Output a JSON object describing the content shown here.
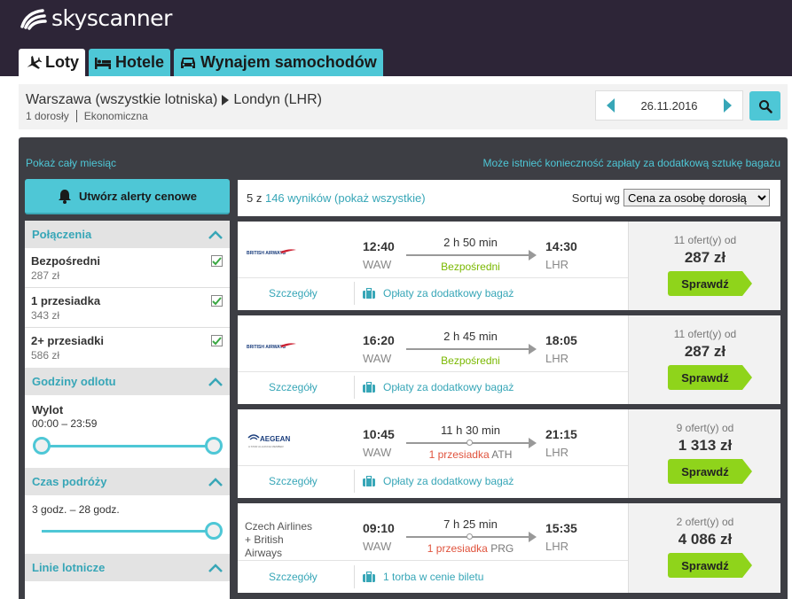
{
  "brand": {
    "name": "skyscanner"
  },
  "tabs": [
    {
      "label": "Loty",
      "icon": "plane-icon",
      "active": true
    },
    {
      "label": "Hotele",
      "icon": "bed-icon",
      "active": false
    },
    {
      "label": "Wynajem samochodów",
      "icon": "car-icon",
      "active": false
    }
  ],
  "search": {
    "origin": "Warszawa (wszystkie lotniska)",
    "destination": "Londyn (LHR)",
    "passengers": "1 dorosły",
    "cabin": "Ekonomiczna",
    "date": "26.11.2016"
  },
  "links": {
    "month": "Pokaż cały miesiąc",
    "baggage_notice": "Może istnieć konieczność zapłaty za dodatkową sztukę bagażu"
  },
  "sidebar": {
    "alert_button": "Utwórz alerty cenowe",
    "connections_title": "Połączenia",
    "connections": [
      {
        "name": "Bezpośredni",
        "price": "287 zł",
        "checked": true
      },
      {
        "name": "1 przesiadka",
        "price": "343 zł",
        "checked": true
      },
      {
        "name": "2+ przesiadki",
        "price": "586 zł",
        "checked": true
      }
    ],
    "departure_title": "Godziny odlotu",
    "departure_label": "Wylot",
    "departure_range": "00:00 – 23:59",
    "duration_title": "Czas podróży",
    "duration_range": "3 godz. – 28 godz.",
    "airlines_title": "Linie lotnicze"
  },
  "results": {
    "count_prefix": "5 z ",
    "count_link": "146 wyników (pokaż wszystkie)",
    "sort_label": "Sortuj wg",
    "sort_value": "Cena za osobę dorosłą",
    "details_label": "Szczegóły",
    "check_label": "Sprawdź",
    "items": [
      {
        "airline": "British Airways",
        "logo": "ba",
        "dep_time": "12:40",
        "dep_code": "WAW",
        "arr_time": "14:30",
        "arr_code": "LHR",
        "duration": "2 h 50 min",
        "stops": "Bezpośredni",
        "stop_via": "",
        "bag_text": "Opłaty za dodatkowy bagaż",
        "offers": "11 ofert(y) od",
        "price": "287 zł"
      },
      {
        "airline": "British Airways",
        "logo": "ba",
        "dep_time": "16:20",
        "dep_code": "WAW",
        "arr_time": "18:05",
        "arr_code": "LHR",
        "duration": "2 h 45 min",
        "stops": "Bezpośredni",
        "stop_via": "",
        "bag_text": "Opłaty za dodatkowy bagaż",
        "offers": "11 ofert(y) od",
        "price": "287 zł"
      },
      {
        "airline": "Aegean",
        "logo": "aegean",
        "dep_time": "10:45",
        "dep_code": "WAW",
        "arr_time": "21:15",
        "arr_code": "LHR",
        "duration": "11 h 30 min",
        "stops": "1 przesiadka",
        "stop_via": "ATH",
        "bag_text": "Opłaty za dodatkowy bagaż",
        "offers": "9 ofert(y) od",
        "price": "1 313 zł"
      },
      {
        "airline": "Czech Airlines + British Airways",
        "airline_lines": [
          "Czech Airlines",
          "+ British",
          "Airways"
        ],
        "logo": "text",
        "dep_time": "09:10",
        "dep_code": "WAW",
        "arr_time": "15:35",
        "arr_code": "LHR",
        "duration": "7 h 25 min",
        "stops": "1 przesiadka",
        "stop_via": "PRG",
        "bag_text": "1 torba w cenie biletu",
        "offers": "2 ofert(y) od",
        "price": "4 086 zł"
      }
    ]
  },
  "colors": {
    "accent": "#4ec7d6",
    "header": "#2d2537",
    "cta": "#8fd41b",
    "direct": "#7ab800",
    "stop": "#e0533d"
  }
}
